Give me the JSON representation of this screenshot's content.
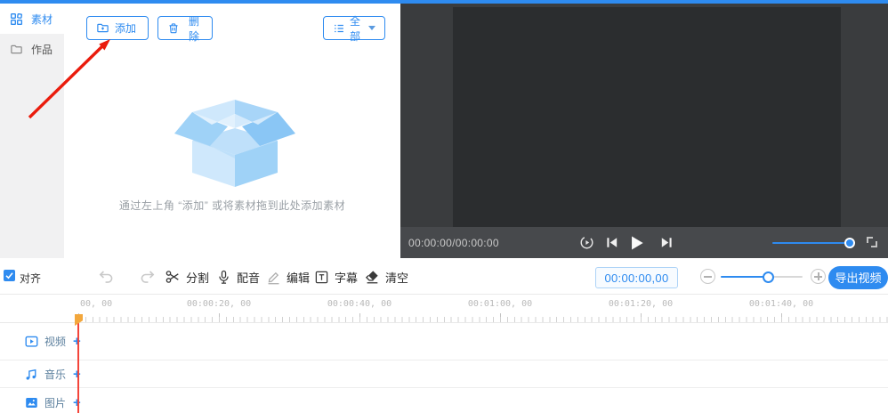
{
  "colors": {
    "accent": "#2e8bf0",
    "topbar": "#2e8bf0",
    "playhead_line": "#f4453a",
    "playhead_flag": "#f3a73c",
    "preview_bg": "#3a3c3e",
    "preview_frame": "#2b2d2f"
  },
  "sidebar": {
    "items": [
      {
        "label": "素材",
        "icon": "grid-icon",
        "active": true
      },
      {
        "label": "作品",
        "icon": "folder-icon",
        "active": false
      }
    ]
  },
  "library": {
    "add_label": "添加",
    "delete_label": "删除",
    "filter_selected": "全部",
    "empty_hint": "通过左上角 “添加” 或将素材拖到此处添加素材"
  },
  "preview": {
    "time_display": "00:00:00/00:00:00"
  },
  "toolbar": {
    "align_label": "对齐",
    "align_checked": true,
    "tools": [
      {
        "label": "分割",
        "icon": "scissors-icon"
      },
      {
        "label": "配音",
        "icon": "microphone-icon"
      },
      {
        "label": "编辑",
        "icon": "pencil-icon"
      },
      {
        "label": "字幕",
        "icon": "subtitle-icon"
      },
      {
        "label": "清空",
        "icon": "eraser-icon"
      }
    ],
    "current_time": "00:00:00,00",
    "export_label": "导出视频"
  },
  "timeline": {
    "ruler_labels": [
      "00, 00",
      "00:00:20, 00",
      "00:00:40, 00",
      "00:01:00, 00",
      "00:01:20, 00",
      "00:01:40, 00"
    ],
    "tracks": [
      {
        "label": "视频",
        "icon": "video-track-icon"
      },
      {
        "label": "音乐",
        "icon": "music-track-icon"
      },
      {
        "label": "图片",
        "icon": "image-track-icon"
      }
    ],
    "add_symbol": "+"
  }
}
